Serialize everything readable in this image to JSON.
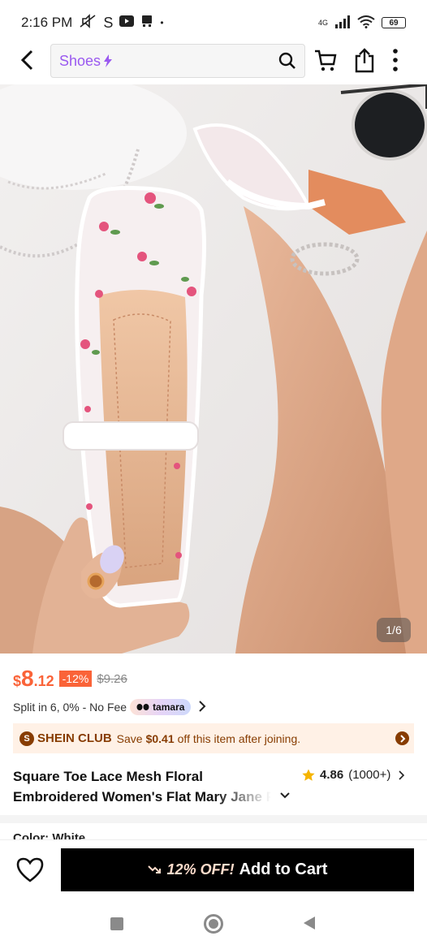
{
  "status_bar": {
    "time": "2:16 PM",
    "carrier_letter": "S",
    "network": "4G",
    "battery": "69"
  },
  "header": {
    "search_term": "Shoes"
  },
  "product": {
    "image_counter": "1/6",
    "price_currency": "$",
    "price_integer": "8",
    "price_decimal": ".12",
    "discount": "-12%",
    "old_price": "$9.26",
    "split_text": "Split in 6, 0% - No Fee",
    "tamara_label": "tamara",
    "club": {
      "logo_letter": "S",
      "name": "SHEIN CLUB",
      "save_prefix": "Save",
      "save_amount": "$0.41",
      "save_suffix": "off this item after joining."
    },
    "title_line1": "Square Toe Lace Mesh Floral",
    "title_line2": "Embroidered Women's Flat Mary Jane Flats",
    "rating": "4.86",
    "review_count": "(1000+)",
    "color_label": "Color: White"
  },
  "bottom_bar": {
    "offer": "12% OFF!",
    "add_to_cart": "Add to Cart"
  },
  "colors": {
    "accent_orange": "#fa6338",
    "search_purple": "#9a59f0",
    "club_brown": "#873c00",
    "star_yellow": "#f5b400"
  }
}
